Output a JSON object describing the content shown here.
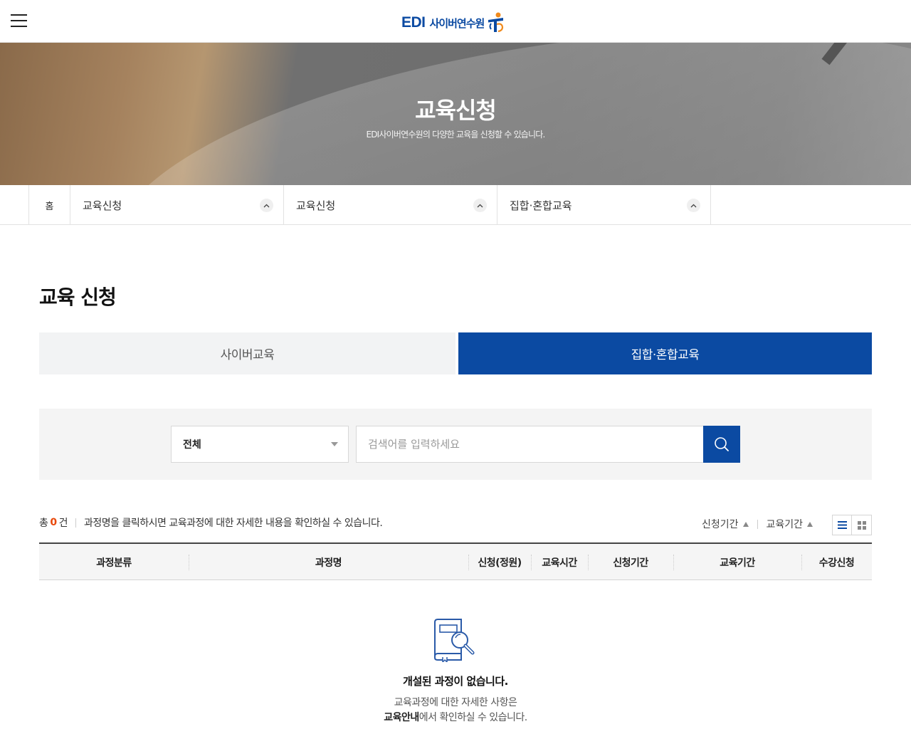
{
  "header": {
    "logo_edi": "EDI",
    "logo_kr": "사이버연수원",
    "brand_color": "#0b4aa2"
  },
  "banner": {
    "title": "교육신청",
    "subtitle": "EDI사이버연수원의 다양한 교육을 신청할 수 있습니다."
  },
  "location": {
    "home": "홈",
    "items": [
      "교육신청",
      "교육신청",
      "집합·혼합교육"
    ]
  },
  "page": {
    "title": "교육 신청"
  },
  "tabs": [
    {
      "label": "사이버교육",
      "active": false
    },
    {
      "label": "집합·혼합교육",
      "active": true
    }
  ],
  "search": {
    "select_value": "전체",
    "placeholder": "검색어를 입력하세요"
  },
  "list": {
    "total_prefix": "총",
    "total_count": "0",
    "total_suffix": "건",
    "guide": "과정명을 클릭하시면 교육과정에 대한 자세한 내용을 확인하실 수 있습니다.",
    "sort_apply": "신청기간",
    "sort_edu": "교육기간"
  },
  "table": {
    "headers": [
      "과정분류",
      "과정명",
      "신청(정원)",
      "교육시간",
      "신청기간",
      "교육기간",
      "수강신청"
    ]
  },
  "empty": {
    "title": "개설된 과정이 없습니다.",
    "desc1": "교육과정에 대한 자세한 사항은",
    "desc2_link": "교육안내",
    "desc2_rest": "에서 확인하실 수 있습니다."
  }
}
